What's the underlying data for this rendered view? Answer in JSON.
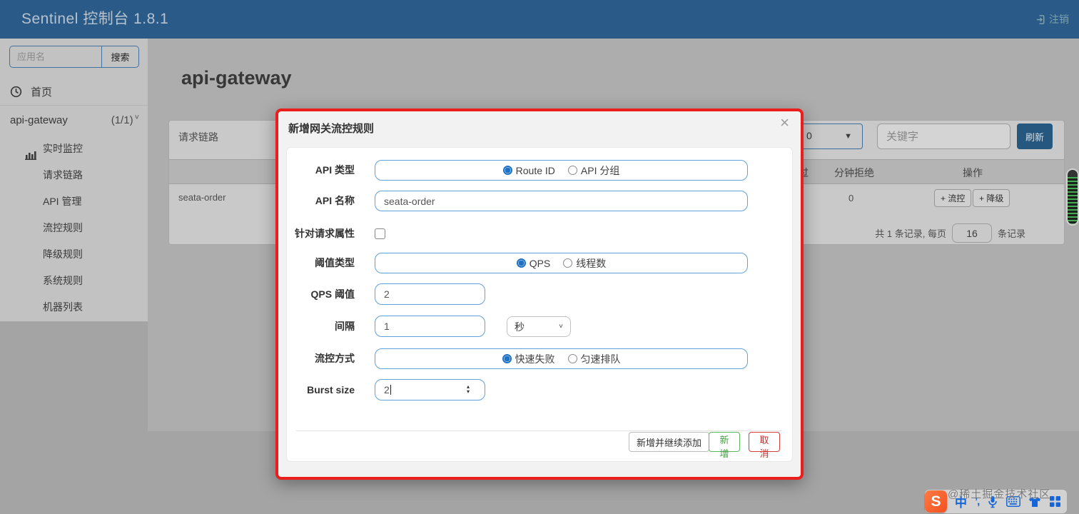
{
  "navbar": {
    "title": "Sentinel 控制台 1.8.1",
    "logout_label": "注销"
  },
  "sidebar": {
    "search_placeholder": "应用名",
    "search_button": "搜索",
    "home_label": "首页",
    "app": {
      "name": "api-gateway",
      "count": "(1/1)"
    },
    "menu": [
      {
        "label": "实时监控"
      },
      {
        "label": "请求链路"
      },
      {
        "label": "API 管理"
      },
      {
        "label": "流控规则"
      },
      {
        "label": "降级规则"
      },
      {
        "label": "系统规则"
      },
      {
        "label": "机器列表"
      }
    ]
  },
  "main": {
    "page_title": "api-gateway",
    "panel": {
      "title": "请求链路",
      "machine_select_visible_text": "0",
      "keyword_placeholder": "关键字",
      "refresh_button": "刷新",
      "table": {
        "header_pass": "分钟通过",
        "header_reject": "分钟拒绝",
        "header_op": "操作",
        "row": {
          "link": "seata-order",
          "reject": "0",
          "flow_button": "+ 流控",
          "degrade_button": "+ 降级"
        }
      },
      "pagination": {
        "prefix": "共 1 条记录, 每页",
        "page_size": "16",
        "suffix": "条记录"
      }
    }
  },
  "modal": {
    "title": "新增网关流控规则",
    "close_glyph": "×",
    "fields": {
      "api_type": {
        "label": "API 类型",
        "options": [
          "Route ID",
          "API 分组"
        ],
        "selected": "Route ID"
      },
      "api_name": {
        "label": "API 名称",
        "value": "seata-order"
      },
      "request_attr": {
        "label": "针对请求属性",
        "checked": false
      },
      "threshold_type": {
        "label": "阈值类型",
        "options": [
          "QPS",
          "线程数"
        ],
        "selected": "QPS"
      },
      "qps_threshold": {
        "label": "QPS 阈值",
        "value": "2"
      },
      "interval": {
        "label": "间隔",
        "value": "1",
        "unit": "秒"
      },
      "flow_mode": {
        "label": "流控方式",
        "options": [
          "快速失败",
          "匀速排队"
        ],
        "selected": "快速失败"
      },
      "burst_size": {
        "label": "Burst size",
        "value": "2"
      }
    },
    "buttons": {
      "add_continue": "新增并继续添加",
      "add": "新增",
      "cancel": "取消"
    }
  },
  "watermark_text": "@稀土掘金技术社区",
  "ime": {
    "logo": "S",
    "lang": "中",
    "punct": "’,"
  },
  "colors": {
    "accent_blue": "#2a5a88",
    "modal_border_red": "#ec1e1b",
    "ok_green": "#5cb85c",
    "danger_red": "#d43f3a",
    "input_border_blue": "#62a0d8"
  }
}
